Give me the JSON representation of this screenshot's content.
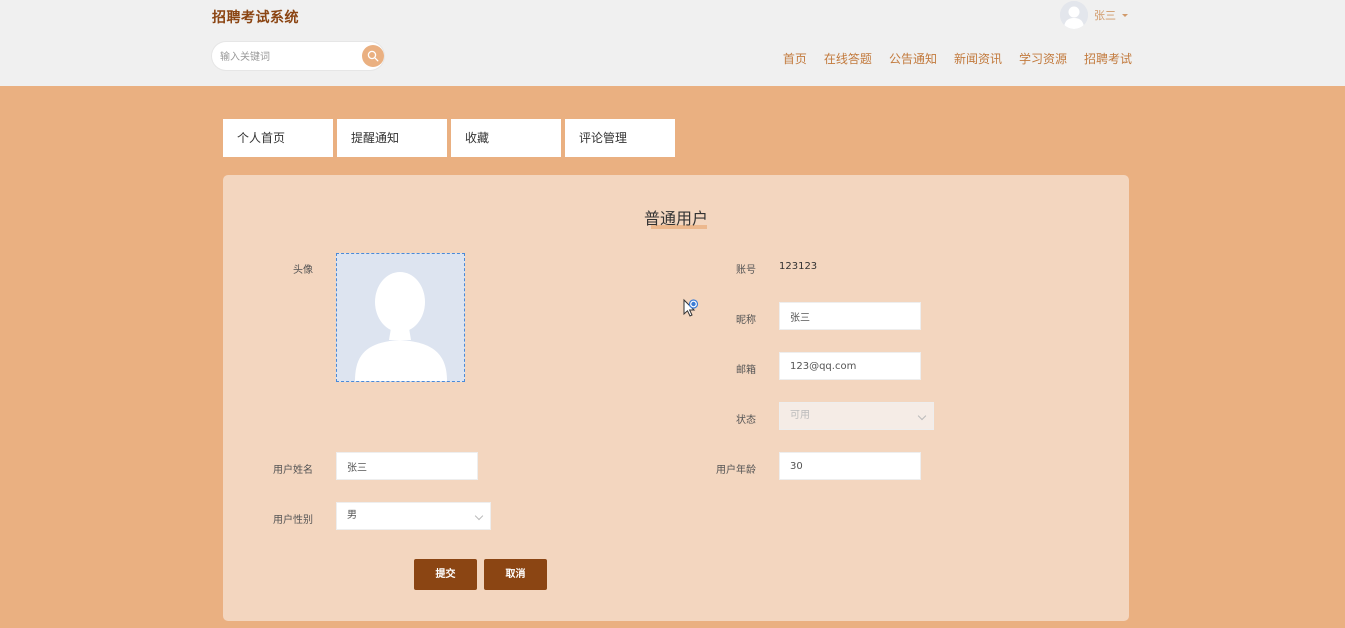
{
  "app": {
    "title": "招聘考试系统"
  },
  "search": {
    "placeholder": "输入关键词"
  },
  "user": {
    "name": "张三"
  },
  "nav": {
    "items": [
      "首页",
      "在线答题",
      "公告通知",
      "新闻资讯",
      "学习资源",
      "招聘考试"
    ]
  },
  "tabs": [
    "个人首页",
    "提醒通知",
    "收藏",
    "评论管理"
  ],
  "form": {
    "title": "普通用户",
    "avatar_label": "头像",
    "account_label": "账号",
    "account_value": "123123",
    "nickname_label": "昵称",
    "nickname_value": "张三",
    "email_label": "邮箱",
    "email_value": "123@qq.com",
    "status_label": "状态",
    "status_value": "可用",
    "real_name_label": "用户姓名",
    "real_name_value": "张三",
    "age_label": "用户年龄",
    "age_value": "30",
    "gender_label": "用户性别",
    "gender_value": "男",
    "submit_label": "提交",
    "cancel_label": "取消"
  },
  "colors": {
    "background": "#eab081",
    "header": "#f0f0f0",
    "panel": "#f3d6bf",
    "brand": "#8b4513",
    "nav_text": "#c27a3d"
  }
}
